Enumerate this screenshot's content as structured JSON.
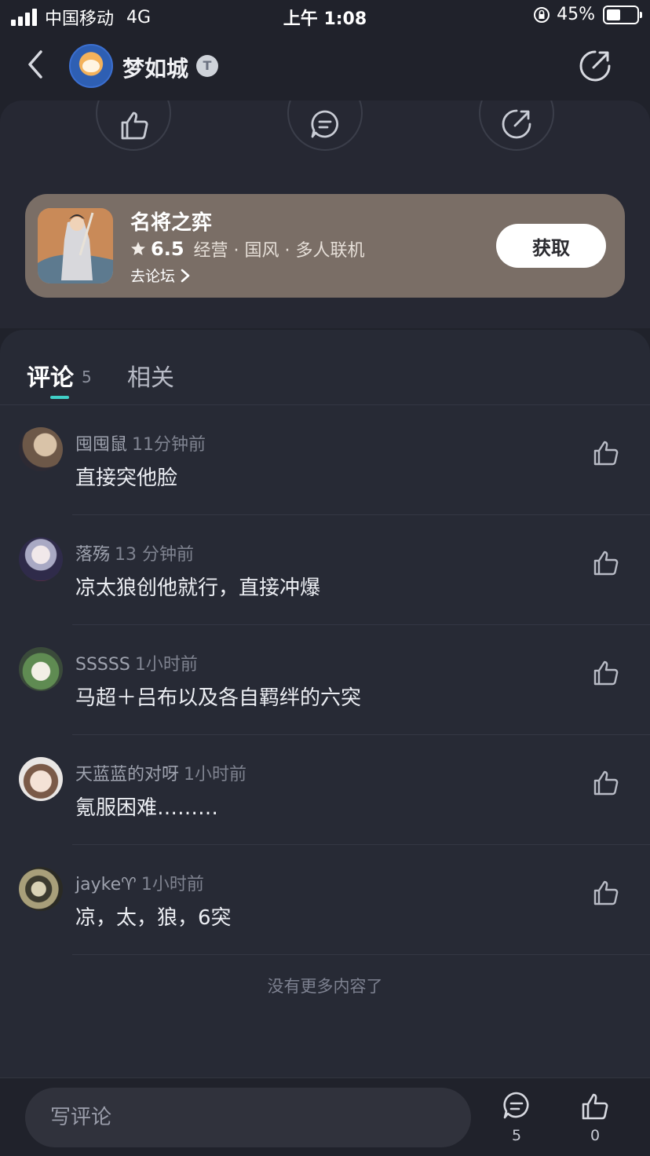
{
  "status_bar": {
    "carrier": "中国移动",
    "network": "4G",
    "time": "上午 1:08",
    "battery": "45%",
    "battery_level": 0.45
  },
  "header": {
    "author_name": "梦如城",
    "badge_letter": "T"
  },
  "game_card": {
    "title": "名将之弈",
    "rating": "6.5",
    "tags": "经营 · 国风 · 多人联机",
    "forum_link": "去论坛",
    "get_button": "获取"
  },
  "tabs": {
    "comments_label": "评论",
    "comments_count": "5",
    "related_label": "相关"
  },
  "comments": [
    {
      "user": "囤囤鼠",
      "time": "11分钟前",
      "text": "直接突他脸"
    },
    {
      "user": "落殇",
      "time": "13 分钟前",
      "text": "凉太狼创他就行，直接冲爆"
    },
    {
      "user": "SSSSS",
      "time": "1小时前",
      "text": "马超＋吕布以及各自羁绊的六突"
    },
    {
      "user": "天蓝蓝的对呀",
      "time": "1小时前",
      "text": "氪服困难………"
    },
    {
      "user": "jayke♈",
      "time": "1小时前",
      "text": "凉，太，狼，6突"
    }
  ],
  "no_more_text": "没有更多内容了",
  "bottom_bar": {
    "input_placeholder": "写评论",
    "comment_count": "5",
    "like_count": "0"
  },
  "colors": {
    "background": "#20222b",
    "card": "#7a6e66",
    "accent": "#40d0c8"
  }
}
